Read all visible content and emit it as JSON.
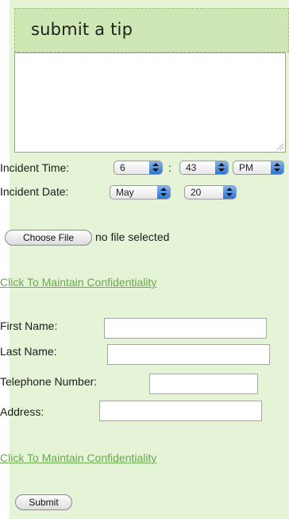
{
  "header": {
    "title": "submit a tip"
  },
  "tip_text": {
    "value": ""
  },
  "incident_time": {
    "label": "Incident Time:",
    "hour": "6",
    "separator": ":",
    "minute": "43",
    "ampm": "PM"
  },
  "incident_date": {
    "label": "Incident Date:",
    "month": "May",
    "day": "20"
  },
  "file": {
    "button_label": "Choose File",
    "status": "no file selected"
  },
  "confidentiality_link_1": "Click To Maintain Confidentiality",
  "form": {
    "first_name_label": "First Name:",
    "first_name_value": "",
    "last_name_label": "Last Name:",
    "last_name_value": "",
    "phone_label": "Telephone Number:",
    "phone_value": "",
    "address_label": "Address:",
    "address_value": ""
  },
  "confidentiality_link_2": "Click To Maintain Confidentiality",
  "submit_label": "Submit",
  "colors": {
    "panel_bg": "#e5f4d7",
    "header_bg": "#cfe7b4",
    "link": "#6aa84f"
  }
}
